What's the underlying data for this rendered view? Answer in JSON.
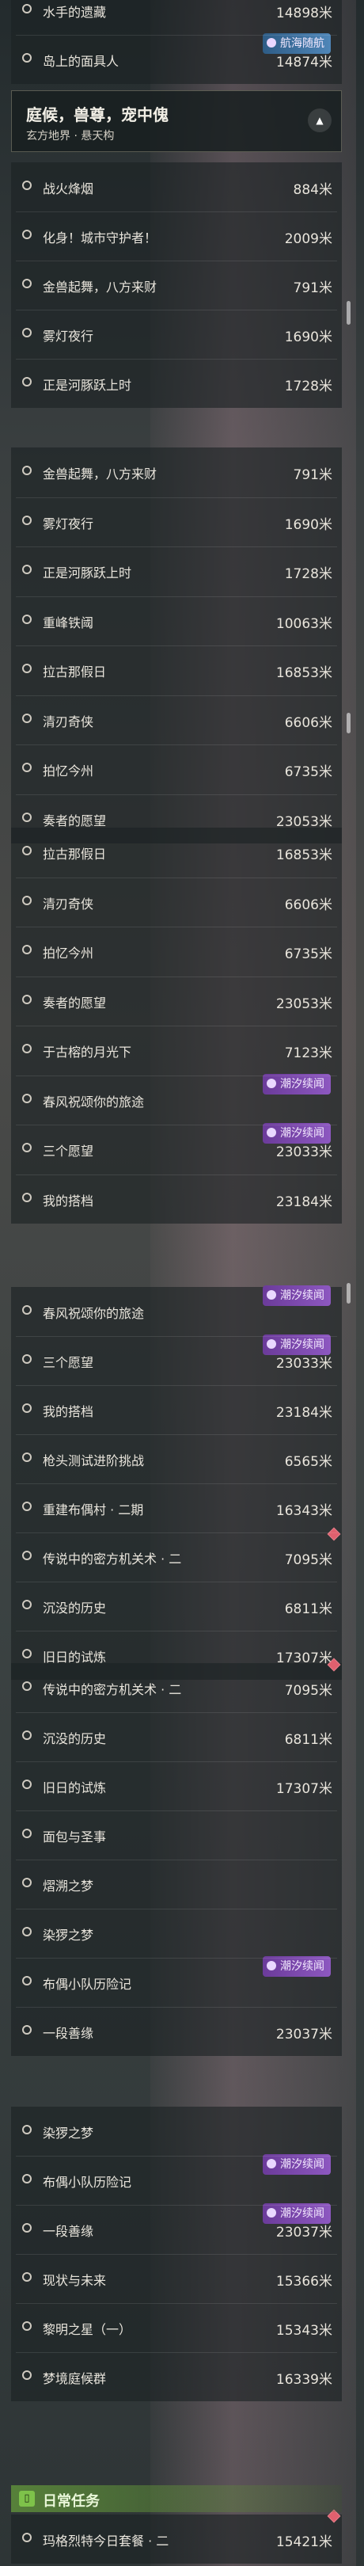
{
  "section": {
    "title": "庭候，兽尊，宠中傀",
    "subtitle": "玄方地界 · 悬天构"
  },
  "daily_title": "日常任务",
  "segments": [
    {
      "rows": [
        {
          "label": "水手的遗藏",
          "distance": "14898米",
          "badge": null
        },
        {
          "label": "岛上的面具人",
          "distance": "14874米",
          "badge": {
            "text": "航海随航",
            "color": "blue"
          }
        }
      ]
    },
    {
      "rows": [
        {
          "label": "战火烽烟",
          "distance": "884米"
        },
        {
          "label": "化身！城市守护者！",
          "distance": "2009米"
        },
        {
          "label": "金兽起舞，八方来财",
          "distance": "791米"
        },
        {
          "label": "雾灯夜行",
          "distance": "1690米"
        },
        {
          "label": "正是河豚跃上时",
          "distance": "1728米"
        }
      ]
    },
    {
      "rows": [
        {
          "label": "金兽起舞，八方来财",
          "distance": "791米"
        },
        {
          "label": "雾灯夜行",
          "distance": "1690米"
        },
        {
          "label": "正是河豚跃上时",
          "distance": "1728米"
        },
        {
          "label": "重峰铁阈",
          "distance": "10063米"
        },
        {
          "label": "拉古那假日",
          "distance": "16853米"
        },
        {
          "label": "清刃奇侠",
          "distance": "6606米"
        },
        {
          "label": "拍忆今州",
          "distance": "6735米"
        },
        {
          "label": "奏者的愿望",
          "distance": "23053米"
        }
      ]
    },
    {
      "rows": [
        {
          "label": "拉古那假日",
          "distance": "16853米"
        },
        {
          "label": "清刃奇侠",
          "distance": "6606米"
        },
        {
          "label": "拍忆今州",
          "distance": "6735米"
        },
        {
          "label": "奏者的愿望",
          "distance": "23053米"
        },
        {
          "label": "于古榕的月光下",
          "distance": "7123米"
        },
        {
          "label": "春风祝颂你的旅途",
          "distance": "",
          "badge": {
            "text": "潮汐续闻",
            "color": "purple"
          }
        },
        {
          "label": "三个愿望",
          "distance": "23033米",
          "badge": {
            "text": "潮汐续闻",
            "color": "purple"
          }
        },
        {
          "label": "我的搭档",
          "distance": "23184米"
        }
      ]
    },
    {
      "rows": [
        {
          "label": "春风祝颂你的旅途",
          "distance": "",
          "badge": {
            "text": "潮汐续闻",
            "color": "purple"
          }
        },
        {
          "label": "三个愿望",
          "distance": "23033米",
          "badge": {
            "text": "潮汐续闻",
            "color": "purple"
          }
        },
        {
          "label": "我的搭档",
          "distance": "23184米"
        },
        {
          "label": "枪头测试进阶挑战",
          "distance": "6565米"
        },
        {
          "label": "重建布偶村 · 二期",
          "distance": "16343米"
        },
        {
          "label": "传说中的密方机关术 · 二",
          "distance": "7095米",
          "diamond": true
        },
        {
          "label": "沉没的历史",
          "distance": "6811米"
        },
        {
          "label": "旧日的试炼",
          "distance": "17307米"
        }
      ]
    },
    {
      "rows": [
        {
          "label": "传说中的密方机关术 · 二",
          "distance": "7095米",
          "diamond": true
        },
        {
          "label": "沉没的历史",
          "distance": "6811米"
        },
        {
          "label": "旧日的试炼",
          "distance": "17307米"
        },
        {
          "label": "面包与圣事",
          "distance": ""
        },
        {
          "label": "熠溯之梦",
          "distance": ""
        },
        {
          "label": "染猡之梦",
          "distance": ""
        },
        {
          "label": "布偶小队历险记",
          "distance": "",
          "badge": {
            "text": "潮汐续闻",
            "color": "purple"
          }
        },
        {
          "label": "一段善缘",
          "distance": "23037米"
        }
      ]
    },
    {
      "rows": [
        {
          "label": "染猡之梦",
          "distance": ""
        },
        {
          "label": "布偶小队历险记",
          "distance": "",
          "badge": {
            "text": "潮汐续闻",
            "color": "purple"
          }
        },
        {
          "label": "一段善缘",
          "distance": "23037米",
          "badge": {
            "text": "潮汐续闻",
            "color": "purple"
          }
        },
        {
          "label": "现状与未来",
          "distance": "15366米"
        },
        {
          "label": "黎明之星（一）",
          "distance": "15343米"
        },
        {
          "label": "梦境庭候群",
          "distance": "16339米"
        }
      ]
    },
    {
      "rows": [
        {
          "label": "玛格烈特今日套餐 · 二",
          "distance": "15421米",
          "diamond": true
        }
      ]
    }
  ]
}
